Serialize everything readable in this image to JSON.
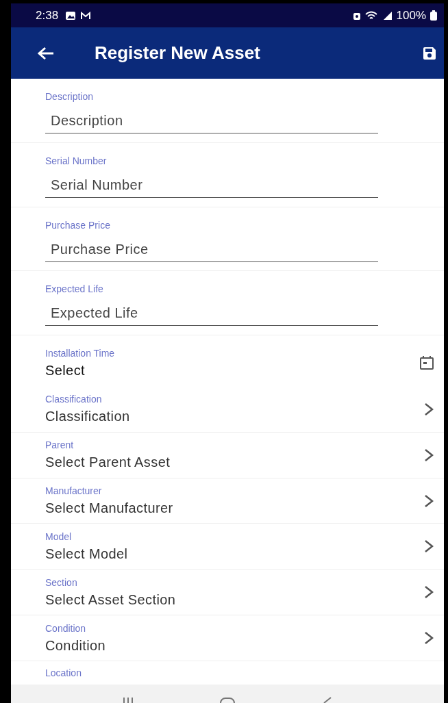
{
  "status_bar": {
    "time": "2:38",
    "battery": "100%"
  },
  "app_bar": {
    "title": "Register New Asset"
  },
  "fields": [
    {
      "kind": "text",
      "label": "Description",
      "placeholder": "Description"
    },
    {
      "kind": "text",
      "label": "Serial Number",
      "placeholder": "Serial Number"
    },
    {
      "kind": "text",
      "label": "Purchase Price",
      "placeholder": "Purchase Price"
    },
    {
      "kind": "text",
      "label": "Expected Life",
      "placeholder": "Expected Life"
    },
    {
      "kind": "date",
      "label": "Installation Time",
      "value": "Select"
    },
    {
      "kind": "picker",
      "label": "Classification",
      "value": "Classification"
    },
    {
      "kind": "picker",
      "label": "Parent",
      "value": "Select Parent Asset"
    },
    {
      "kind": "picker",
      "label": "Manufacturer",
      "value": "Select Manufacturer"
    },
    {
      "kind": "picker",
      "label": "Model",
      "value": "Select Model"
    },
    {
      "kind": "picker",
      "label": "Section",
      "value": "Select Asset Section"
    },
    {
      "kind": "picker",
      "label": "Condition",
      "value": "Condition"
    },
    {
      "kind": "partial",
      "label": "Location"
    }
  ]
}
